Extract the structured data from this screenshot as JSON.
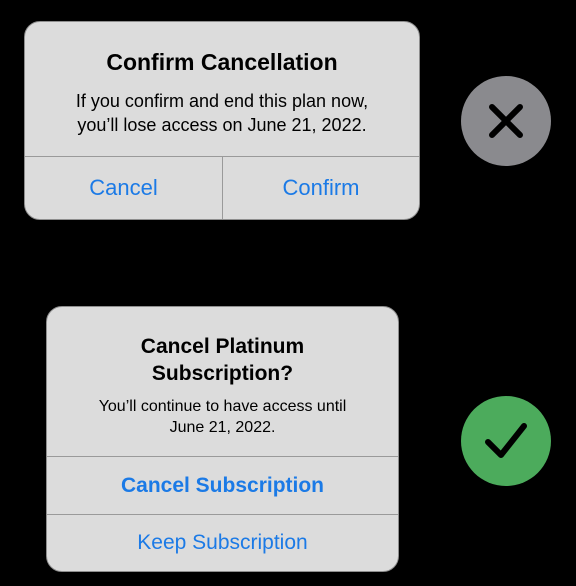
{
  "colors": {
    "background": "#000000",
    "alert_background": "#dcdcdc",
    "button_text": "#1b7ae6",
    "incorrect_badge": "#8a8a8e",
    "correct_badge": "#4cab5c"
  },
  "alert_1": {
    "title": "Confirm Cancellation",
    "message_line_1": "If you confirm and end this plan now,",
    "message_line_2": "you’ll lose access on June 21, 2022.",
    "cancel_label": "Cancel",
    "confirm_label": "Confirm"
  },
  "alert_2": {
    "title_line_1": "Cancel Platinum",
    "title_line_2": "Subscription?",
    "message_line_1": "You’ll continue to have access until",
    "message_line_2": "June 21, 2022.",
    "primary_label": "Cancel Subscription",
    "secondary_label": "Keep Subscription"
  },
  "badges": {
    "incorrect_icon": "x-mark-icon",
    "correct_icon": "checkmark-icon"
  }
}
